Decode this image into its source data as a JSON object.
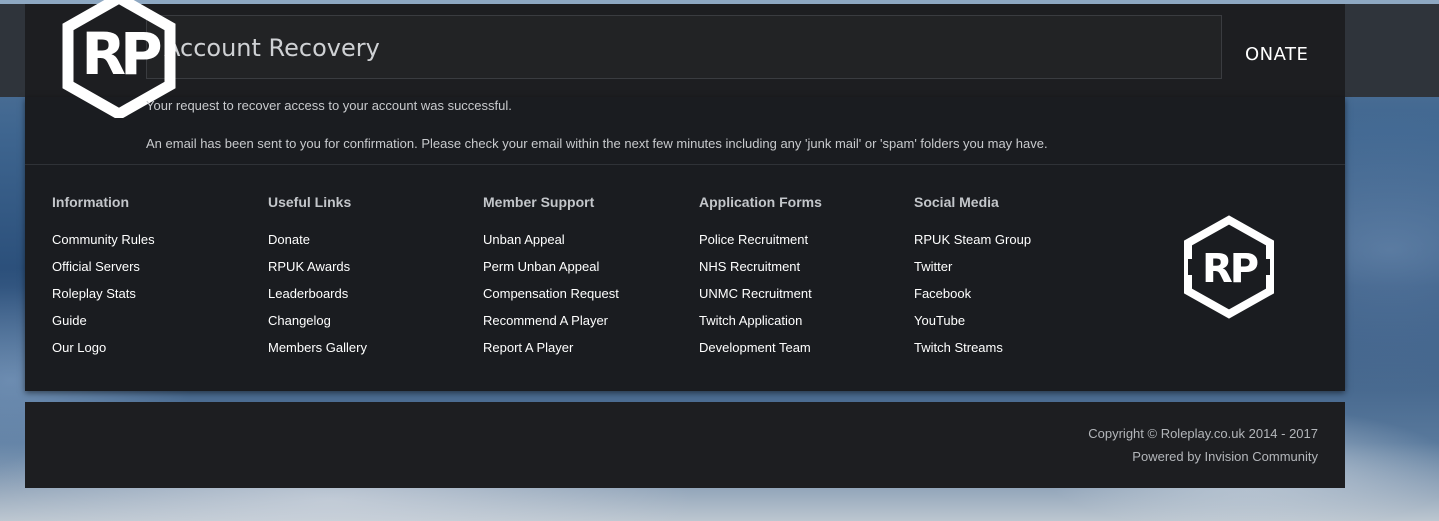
{
  "header": {
    "nav_item_partial": "ONATE"
  },
  "page": {
    "title": "Account Recovery",
    "message_1": "Your request to recover access to your account was successful.",
    "message_2": "An email has been sent to you for confirmation. Please check your email within the next few minutes including any 'junk mail' or 'spam' folders you may have."
  },
  "footer": {
    "columns": [
      {
        "heading": "Information",
        "links": [
          "Community Rules",
          "Official Servers",
          "Roleplay Stats",
          "Guide",
          "Our Logo"
        ]
      },
      {
        "heading": "Useful Links",
        "links": [
          "Donate",
          "RPUK Awards",
          "Leaderboards",
          "Changelog",
          "Members Gallery"
        ]
      },
      {
        "heading": "Member Support",
        "links": [
          "Unban Appeal",
          "Perm Unban Appeal",
          "Compensation Request",
          "Recommend A Player",
          "Report A Player"
        ]
      },
      {
        "heading": "Application Forms",
        "links": [
          "Police Recruitment",
          "NHS Recruitment",
          "UNMC Recruitment",
          "Twitch Application",
          "Development Team"
        ]
      },
      {
        "heading": "Social Media",
        "links": [
          "RPUK Steam Group",
          "Twitter",
          "Facebook",
          "YouTube",
          "Twitch Streams"
        ]
      }
    ],
    "copyright": "Copyright © Roleplay.co.uk 2014 - 2017",
    "powered_by": "Powered by Invision Community"
  },
  "logo_text": "RP",
  "colors": {
    "panel": "#1a1c20",
    "header": "#1d1e21",
    "text": "#ffffff"
  }
}
